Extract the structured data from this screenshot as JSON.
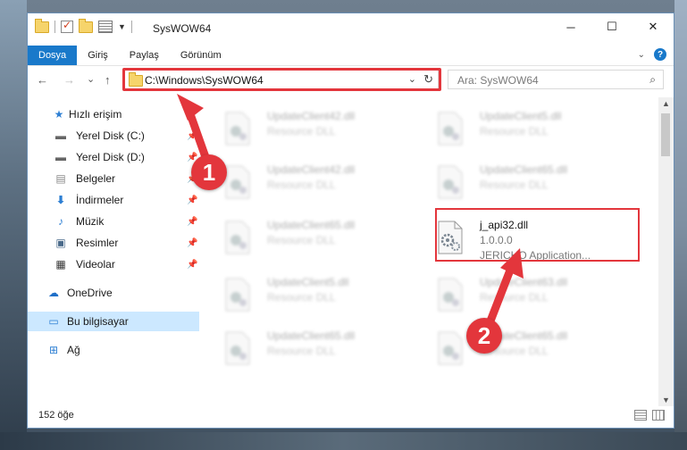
{
  "window": {
    "title": "SysWOW64",
    "controls": {
      "minimize": "─",
      "maximize": "☐",
      "close": "✕"
    }
  },
  "ribbon": {
    "tabs": [
      {
        "label": "Dosya",
        "active": true
      },
      {
        "label": "Giriş",
        "active": false
      },
      {
        "label": "Paylaş",
        "active": false
      },
      {
        "label": "Görünüm",
        "active": false
      }
    ]
  },
  "navigation": {
    "back": "←",
    "forward": "→",
    "recent": "⌄",
    "up": "↑",
    "address": "C:\\Windows\\SysWOW64",
    "search_placeholder": "Ara: SysWOW64"
  },
  "sidebar": {
    "items": [
      {
        "label": "Hızlı erişim",
        "icon": "star-icon",
        "pinned": false
      },
      {
        "label": "Yerel Disk (C:)",
        "icon": "drive-icon",
        "pinned": true
      },
      {
        "label": "Yerel Disk (D:)",
        "icon": "drive-icon",
        "pinned": true
      },
      {
        "label": "Belgeler",
        "icon": "documents-icon",
        "pinned": true
      },
      {
        "label": "İndirmeler",
        "icon": "download-icon",
        "pinned": true
      },
      {
        "label": "Müzik",
        "icon": "music-icon",
        "pinned": true
      },
      {
        "label": "Resimler",
        "icon": "pictures-icon",
        "pinned": true
      },
      {
        "label": "Videolar",
        "icon": "video-icon",
        "pinned": true
      },
      {
        "label": "OneDrive",
        "icon": "cloud-icon",
        "pinned": false
      },
      {
        "label": "Bu bilgisayar",
        "icon": "computer-icon",
        "pinned": false,
        "selected": true
      },
      {
        "label": "Ağ",
        "icon": "network-icon",
        "pinned": false
      }
    ]
  },
  "files": [
    {
      "name": "UpdateClient42.dll",
      "desc": "Resource DLL"
    },
    {
      "name": "UpdateClient5.dll",
      "desc": "Resource DLL"
    },
    {
      "name": "UpdateClient42.dll",
      "desc": "Resource DLL"
    },
    {
      "name": "UpdateClient65.dll",
      "desc": "Resource DLL"
    },
    {
      "name": "UpdateClient65.dll",
      "desc": "Resource DLL"
    },
    {
      "name": "j_api32.dll",
      "version": "1.0.0.0",
      "desc": "JERICHO Application..."
    },
    {
      "name": "UpdateClient5.dll",
      "desc": "Resource DLL"
    },
    {
      "name": "UpdateClient63.dll",
      "desc": "Resource DLL"
    },
    {
      "name": "UpdateClient65.dll",
      "desc": "Resource DLL"
    },
    {
      "name": "UpdateClient65.dll",
      "desc": "Resource DLL"
    }
  ],
  "status": {
    "count": "152 öğe"
  },
  "annotations": {
    "step1": "1",
    "step2": "2"
  },
  "colors": {
    "accent": "#1979ca",
    "highlight": "#e3363c",
    "selected": "#cce8ff"
  }
}
